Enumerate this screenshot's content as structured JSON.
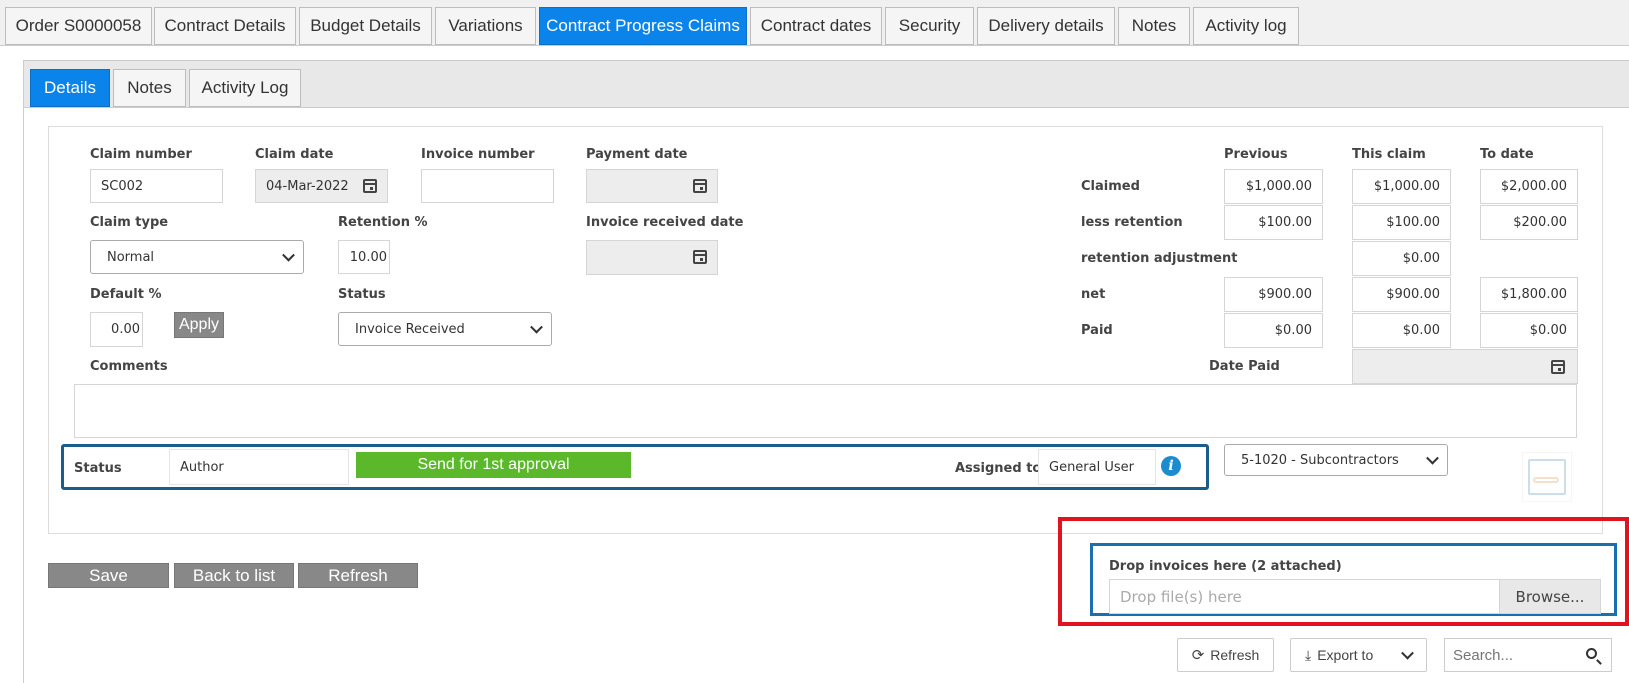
{
  "top_tabs": [
    "Order S0000058",
    "Contract Details",
    "Budget Details",
    "Variations",
    "Contract Progress Claims",
    "Contract dates",
    "Security",
    "Delivery details",
    "Notes",
    "Activity log"
  ],
  "sub_tabs": [
    "Details",
    "Notes",
    "Activity Log"
  ],
  "form": {
    "claim_number_label": "Claim number",
    "claim_number": "SC002",
    "claim_date_label": "Claim date",
    "claim_date": "04-Mar-2022",
    "invoice_number_label": "Invoice number",
    "invoice_number": "",
    "payment_date_label": "Payment date",
    "claim_type_label": "Claim type",
    "claim_type": "Normal",
    "retention_label": "Retention %",
    "retention": "10.00",
    "invoice_received_date_label": "Invoice received date",
    "default_label": "Default %",
    "default_value": "0.00",
    "apply_label": "Apply",
    "status_label": "Status",
    "status": "Invoice Received",
    "comments_label": "Comments",
    "comments": ""
  },
  "totals": {
    "col_previous": "Previous",
    "col_this_claim": "This claim",
    "col_to_date": "To date",
    "claimed_label": "Claimed",
    "claimed": [
      "$1,000.00",
      "$1,000.00",
      "$2,000.00"
    ],
    "less_retention_label": "less retention",
    "less_retention": [
      "$100.00",
      "$100.00",
      "$200.00"
    ],
    "retention_adjustment_label": "retention adjustment",
    "retention_adjustment": "$0.00",
    "net_label": "net",
    "net": [
      "$900.00",
      "$900.00",
      "$1,800.00"
    ],
    "paid_label": "Paid",
    "paid": [
      "$0.00",
      "$0.00",
      "$0.00"
    ],
    "date_paid_label": "Date Paid"
  },
  "workflow": {
    "status_label": "Status",
    "status_value": "Author",
    "send_label": "Send for 1st approval",
    "assigned_label": "Assigned to",
    "assigned_value": "General User"
  },
  "account_select": "5-1020 - Subcontractors",
  "buttons": {
    "save": "Save",
    "back": "Back to list",
    "refresh": "Refresh"
  },
  "dropzone": {
    "title": "Drop invoices here (2 attached)",
    "placeholder": "Drop file(s) here",
    "browse": "Browse..."
  },
  "toolbar": {
    "refresh": "Refresh",
    "export": "Export to",
    "search_placeholder": "Search..."
  },
  "colors": {
    "accent": "#0a84ea",
    "send_green": "#5bb82a",
    "highlight_red": "#e0141e",
    "workflow_border": "#1a5c8c"
  }
}
